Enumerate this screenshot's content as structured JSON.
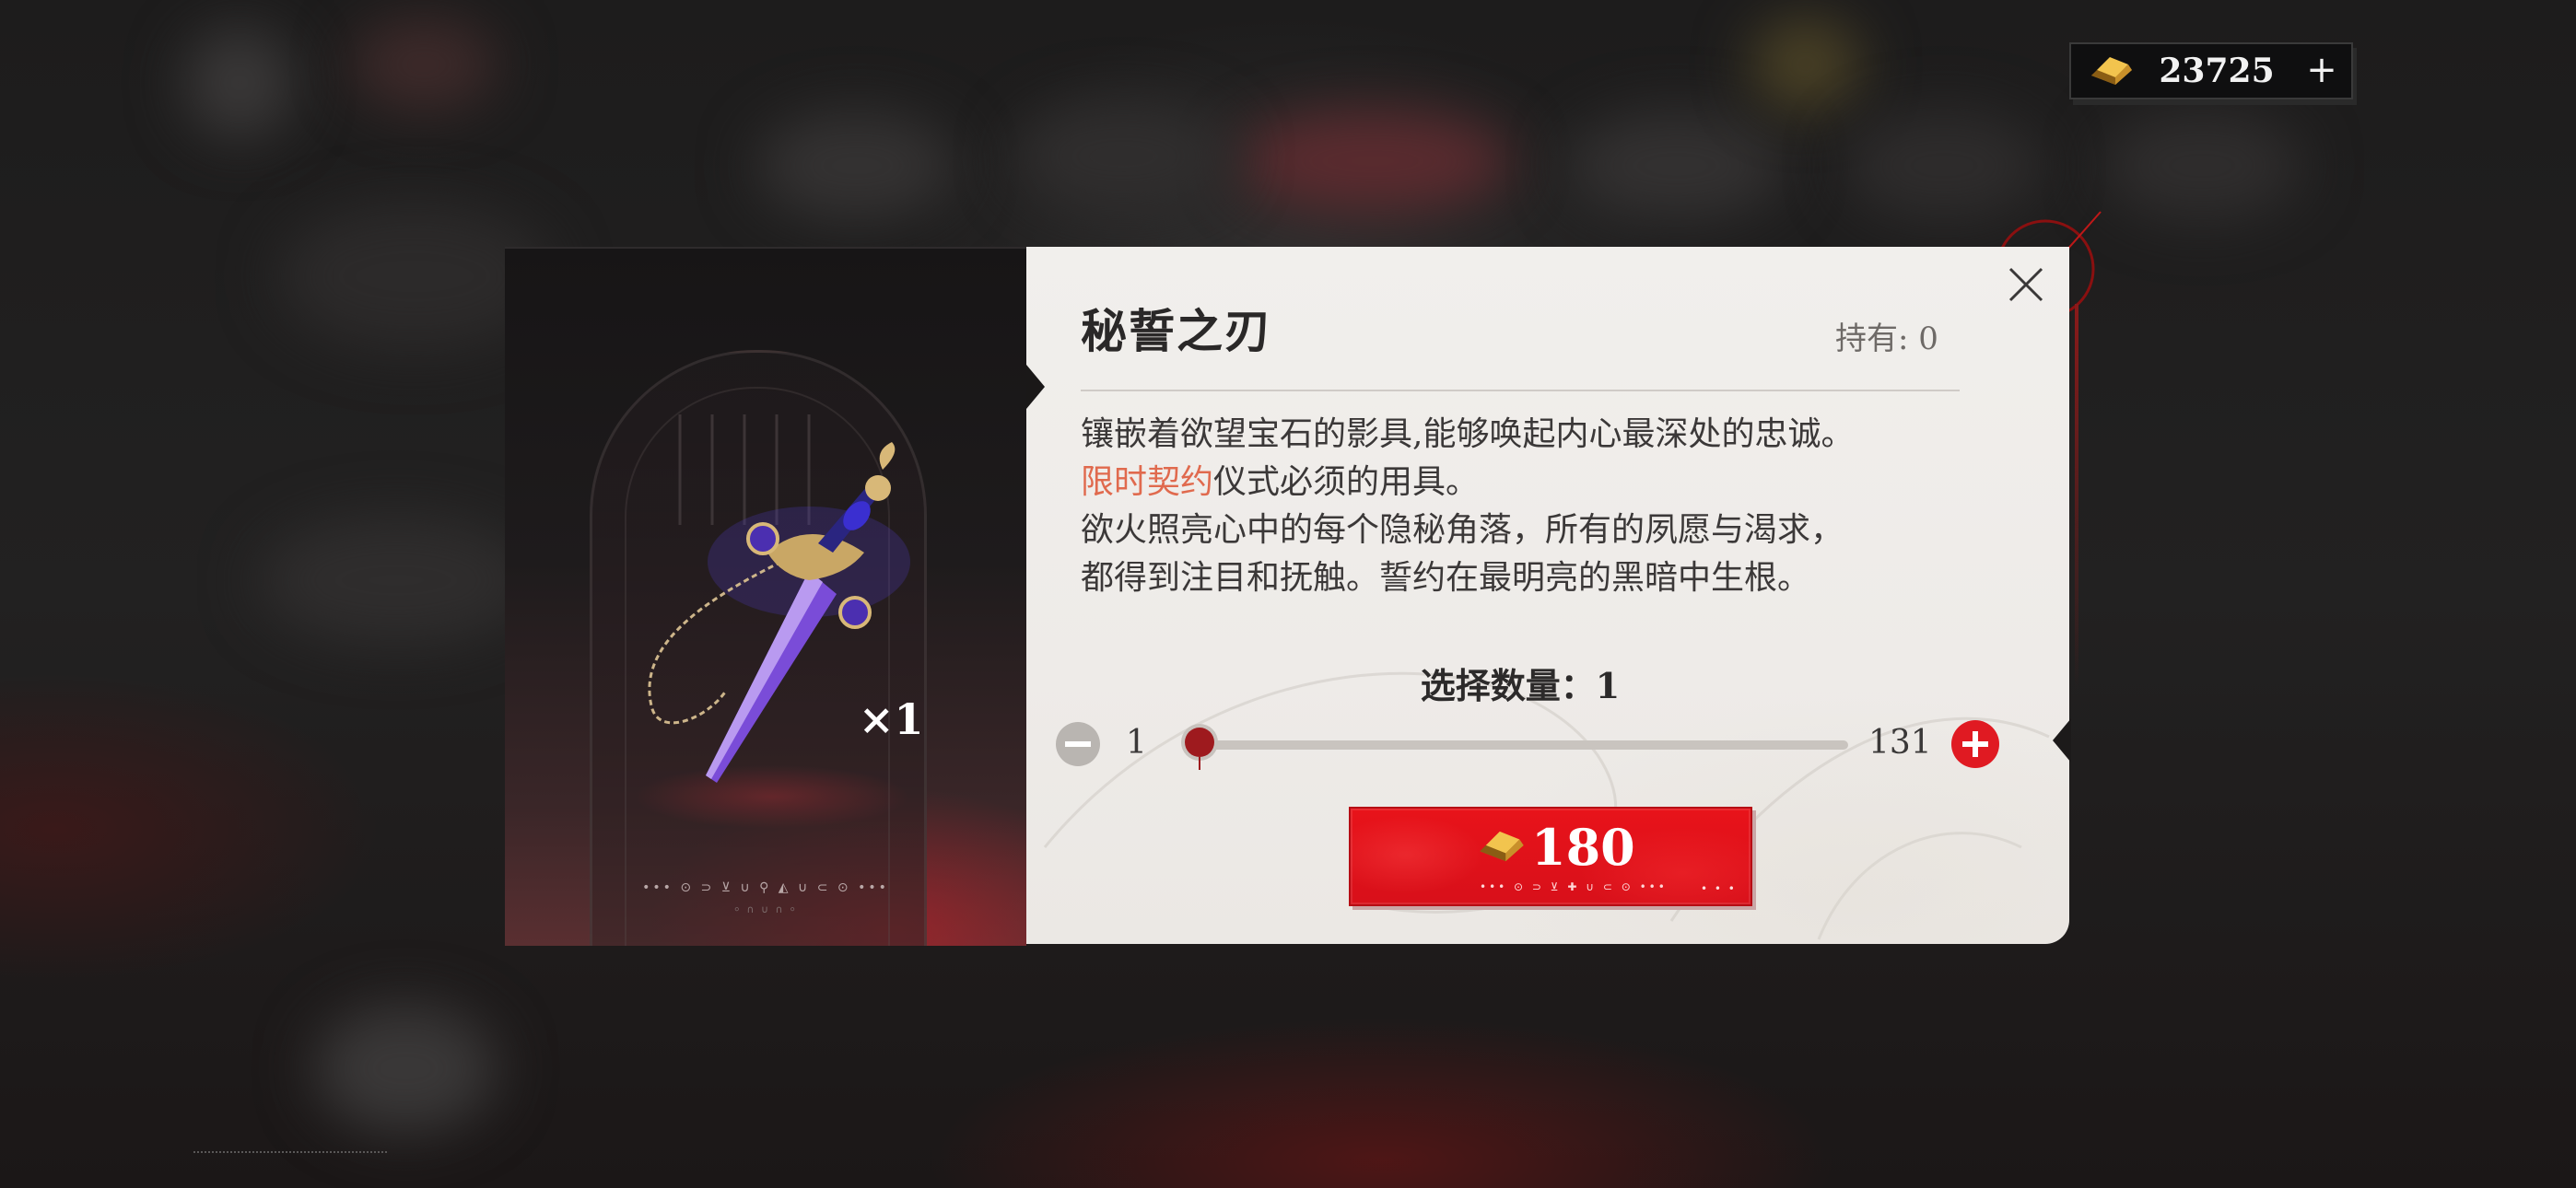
{
  "currency": {
    "icon": "gold-ingot-icon",
    "amount": "23725",
    "add_label": "+"
  },
  "item": {
    "name": "秘誓之刃",
    "owned_label": "持有: 0",
    "quantity_badge": "×1",
    "deco_text": "••• ⊙ ⊃ ⊻ ∪ ⚲ ◭ ∪ ⊂ ⊙ •••",
    "deco_text2": "⸰ ∩ ∪ ∩ ⸰",
    "description": {
      "line1": "镶嵌着欲望宝石的影具,能够唤起内心最深处的忠诚。",
      "line2_highlight": "限时契约",
      "line2_rest": "仪式必须的用具。",
      "line3": "欲火照亮心中的每个隐秘角落，所有的夙愿与渴求，",
      "line4": "都得到注目和抚触。誓约在最明亮的黑暗中生根。"
    }
  },
  "quantity": {
    "label": "选择数量：1",
    "min": "1",
    "max": "131",
    "selected": 1
  },
  "purchase": {
    "price": "180",
    "currency_icon": "gold-ingot-icon",
    "runes": "••• ⊙ ⊃ ⊻ ✚ ∪ ⊂ ⊙ •••",
    "dots": "• • •"
  },
  "colors": {
    "accent_red": "#e8131a",
    "highlight_orange": "#e06a4e",
    "panel_paper": "#efece9",
    "gold": "#d9a93a"
  }
}
